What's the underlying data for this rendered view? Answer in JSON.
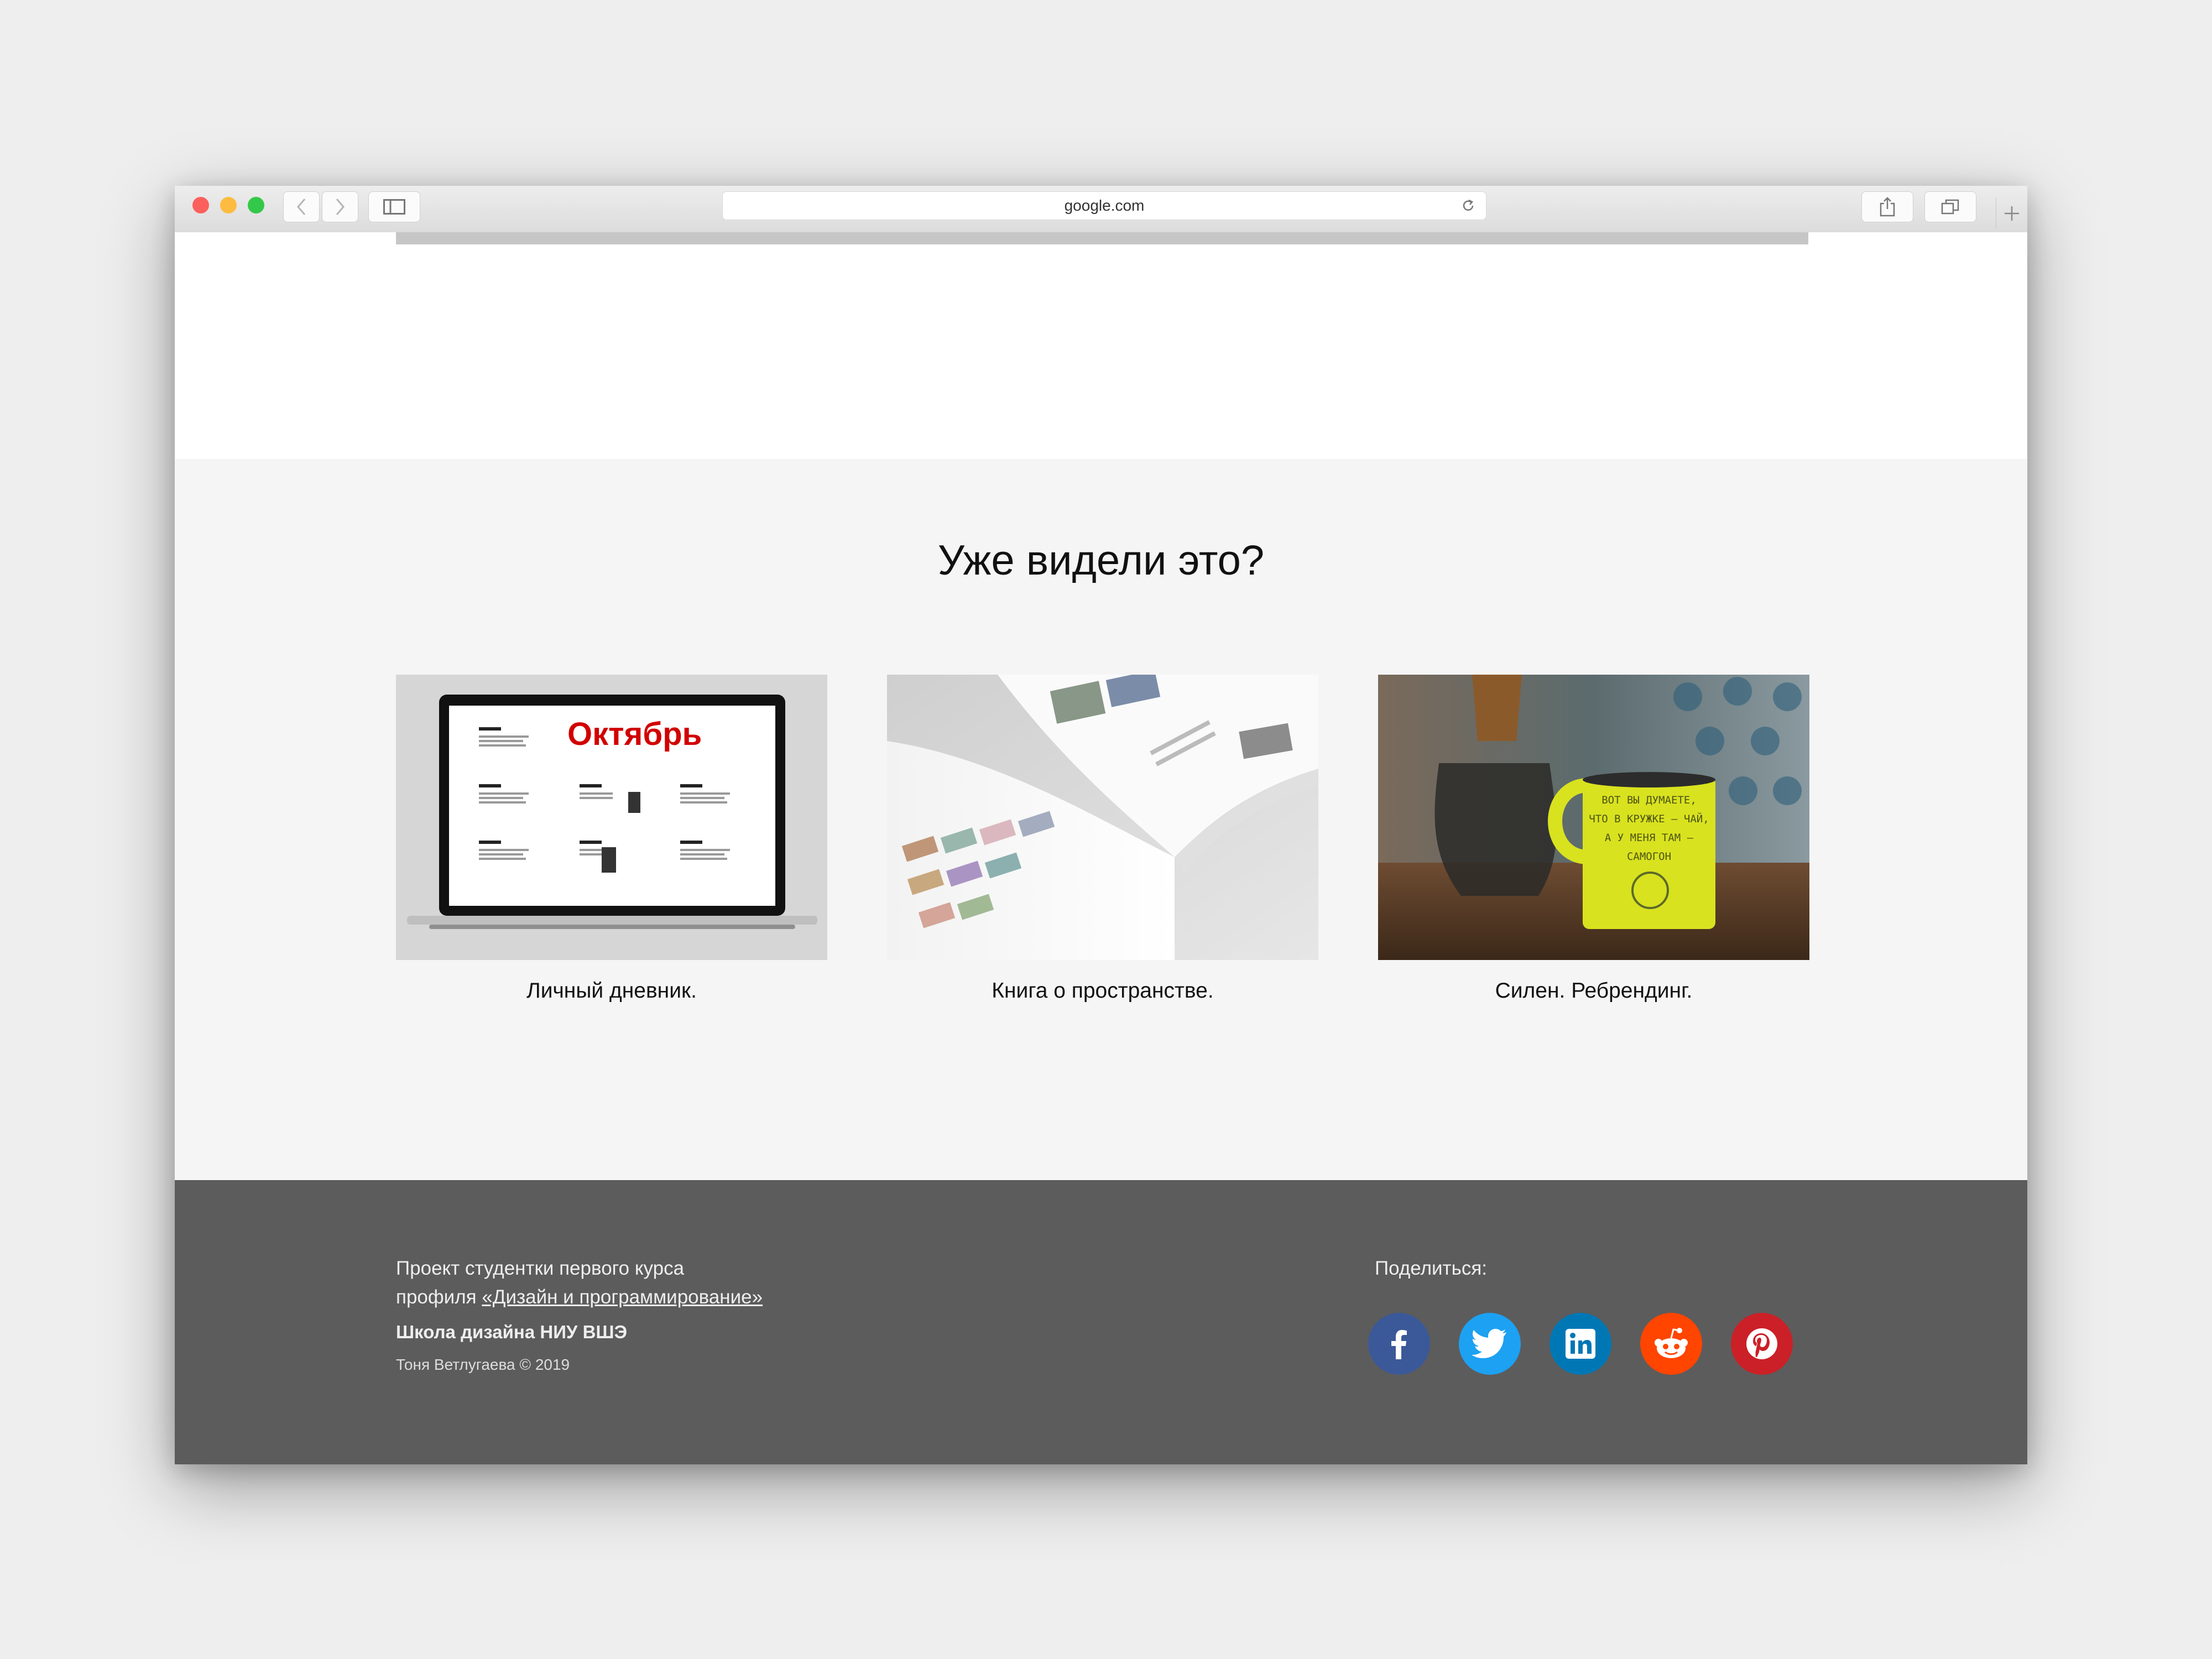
{
  "browser": {
    "url": "google.com"
  },
  "related": {
    "title": "Уже видели это?",
    "cards": [
      {
        "caption": "Личный дневник.",
        "screen_title": "Октябрь"
      },
      {
        "caption": "Книга о пространстве."
      },
      {
        "caption": "Силен. Ребрендинг.",
        "mug_lines": [
          "ВОТ ВЫ ДУМАЕТЕ,",
          "ЧТО В КРУЖКЕ – ЧАЙ,",
          "А У МЕНЯ ТАМ –",
          "САМОГОН"
        ]
      }
    ]
  },
  "footer": {
    "line1": "Проект студентки первого курса",
    "line2_prefix": "профиля ",
    "line2_link": "«Дизайн и программирование»",
    "school": "Школа дизайна НИУ ВШЭ",
    "copyright": "Тоня Ветлугаева © 2019",
    "share_label": "Поделиться:",
    "social": [
      {
        "name": "facebook",
        "color": "#3b5998"
      },
      {
        "name": "twitter",
        "color": "#1da1f2"
      },
      {
        "name": "linkedin",
        "color": "#0077b5"
      },
      {
        "name": "reddit",
        "color": "#ff4500"
      },
      {
        "name": "pinterest",
        "color": "#cb2027"
      }
    ]
  }
}
